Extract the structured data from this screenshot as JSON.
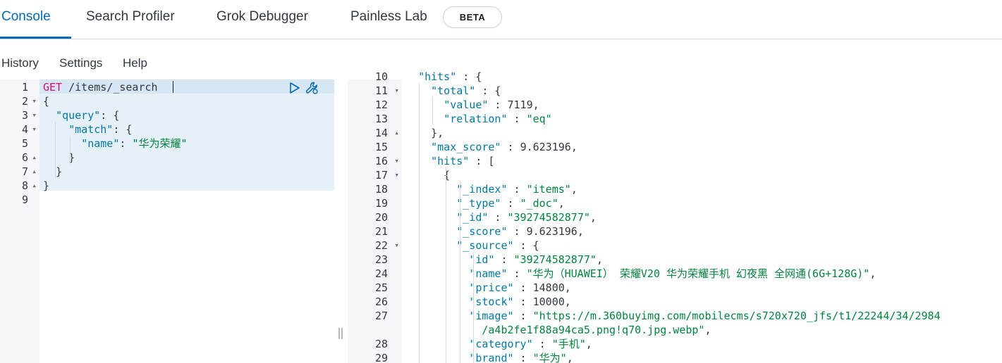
{
  "tabs": [
    {
      "label": "Console",
      "active": true
    },
    {
      "label": "Search Profiler"
    },
    {
      "label": "Grok Debugger"
    },
    {
      "label": "Painless Lab"
    }
  ],
  "beta_badge": "BETA",
  "menu": [
    "History",
    "Settings",
    "Help"
  ],
  "colors": {
    "accent": "#006bb4",
    "string": "#00843d",
    "key": "#0079a5",
    "method": "#dd0a73"
  },
  "icons": {
    "send": "play-icon",
    "settings": "wrench-icon",
    "resize": "resize-handle-icon"
  },
  "request": {
    "line_numbers": [
      "1",
      "2",
      "3",
      "4",
      "5",
      "6",
      "7",
      "8",
      "9"
    ],
    "lines": [
      [
        {
          "t": "m",
          "v": "GET"
        },
        {
          "t": "n",
          "v": " /items/_search"
        }
      ],
      [
        {
          "t": "p",
          "v": "{"
        }
      ],
      [
        {
          "t": "p",
          "v": "  "
        },
        {
          "t": "k",
          "v": "\"query\""
        },
        {
          "t": "p",
          "v": ": {"
        }
      ],
      [
        {
          "t": "p",
          "v": "    "
        },
        {
          "t": "k",
          "v": "\"match\""
        },
        {
          "t": "p",
          "v": ": {"
        }
      ],
      [
        {
          "t": "p",
          "v": "      "
        },
        {
          "t": "k",
          "v": "\"name\""
        },
        {
          "t": "p",
          "v": ": "
        },
        {
          "t": "s",
          "v": "\"华为荣耀\""
        }
      ],
      [
        {
          "t": "p",
          "v": "    }"
        }
      ],
      [
        {
          "t": "p",
          "v": "  }"
        }
      ],
      [
        {
          "t": "p",
          "v": "}"
        }
      ],
      []
    ]
  },
  "response": {
    "line_numbers": [
      "10",
      "11",
      "12",
      "13",
      "14",
      "15",
      "16",
      "17",
      "18",
      "19",
      "20",
      "21",
      "22",
      "23",
      "24",
      "25",
      "26",
      "27",
      "",
      "28",
      "29"
    ],
    "lines": [
      [
        {
          "t": "p",
          "v": "  "
        },
        {
          "t": "k",
          "v": "\"hits\""
        },
        {
          "t": "p",
          "v": " : {"
        }
      ],
      [
        {
          "t": "p",
          "v": "    "
        },
        {
          "t": "k",
          "v": "\"total\""
        },
        {
          "t": "p",
          "v": " : {"
        }
      ],
      [
        {
          "t": "p",
          "v": "      "
        },
        {
          "t": "k",
          "v": "\"value\""
        },
        {
          "t": "p",
          "v": " : "
        },
        {
          "t": "n",
          "v": "7119"
        },
        {
          "t": "p",
          "v": ","
        }
      ],
      [
        {
          "t": "p",
          "v": "      "
        },
        {
          "t": "k",
          "v": "\"relation\""
        },
        {
          "t": "p",
          "v": " : "
        },
        {
          "t": "s",
          "v": "\"eq\""
        }
      ],
      [
        {
          "t": "p",
          "v": "    },"
        }
      ],
      [
        {
          "t": "p",
          "v": "    "
        },
        {
          "t": "k",
          "v": "\"max_score\""
        },
        {
          "t": "p",
          "v": " : "
        },
        {
          "t": "n",
          "v": "9.623196"
        },
        {
          "t": "p",
          "v": ","
        }
      ],
      [
        {
          "t": "p",
          "v": "    "
        },
        {
          "t": "k",
          "v": "\"hits\""
        },
        {
          "t": "p",
          "v": " : ["
        }
      ],
      [
        {
          "t": "p",
          "v": "      {"
        }
      ],
      [
        {
          "t": "p",
          "v": "        "
        },
        {
          "t": "k",
          "v": "\"_index\""
        },
        {
          "t": "p",
          "v": " : "
        },
        {
          "t": "s",
          "v": "\"items\""
        },
        {
          "t": "p",
          "v": ","
        }
      ],
      [
        {
          "t": "p",
          "v": "        "
        },
        {
          "t": "k",
          "v": "\"_type\""
        },
        {
          "t": "p",
          "v": " : "
        },
        {
          "t": "s",
          "v": "\"_doc\""
        },
        {
          "t": "p",
          "v": ","
        }
      ],
      [
        {
          "t": "p",
          "v": "        "
        },
        {
          "t": "k",
          "v": "\"_id\""
        },
        {
          "t": "p",
          "v": " : "
        },
        {
          "t": "s",
          "v": "\"39274582877\""
        },
        {
          "t": "p",
          "v": ","
        }
      ],
      [
        {
          "t": "p",
          "v": "        "
        },
        {
          "t": "k",
          "v": "\"_score\""
        },
        {
          "t": "p",
          "v": " : "
        },
        {
          "t": "n",
          "v": "9.623196"
        },
        {
          "t": "p",
          "v": ","
        }
      ],
      [
        {
          "t": "p",
          "v": "        "
        },
        {
          "t": "k",
          "v": "\"_source\""
        },
        {
          "t": "p",
          "v": " : {"
        }
      ],
      [
        {
          "t": "p",
          "v": "          "
        },
        {
          "t": "k",
          "v": "\"id\""
        },
        {
          "t": "p",
          "v": " : "
        },
        {
          "t": "s",
          "v": "\"39274582877\""
        },
        {
          "t": "p",
          "v": ","
        }
      ],
      [
        {
          "t": "p",
          "v": "          "
        },
        {
          "t": "k",
          "v": "\"name\""
        },
        {
          "t": "p",
          "v": " : "
        },
        {
          "t": "s",
          "v": "\"华为（HUAWEI） 荣耀V20 华为荣耀手机 幻夜黑 全网通(6G+128G)\""
        },
        {
          "t": "p",
          "v": ","
        }
      ],
      [
        {
          "t": "p",
          "v": "          "
        },
        {
          "t": "k",
          "v": "\"price\""
        },
        {
          "t": "p",
          "v": " : "
        },
        {
          "t": "n",
          "v": "14800"
        },
        {
          "t": "p",
          "v": ","
        }
      ],
      [
        {
          "t": "p",
          "v": "          "
        },
        {
          "t": "k",
          "v": "\"stock\""
        },
        {
          "t": "p",
          "v": " : "
        },
        {
          "t": "n",
          "v": "10000"
        },
        {
          "t": "p",
          "v": ","
        }
      ],
      [
        {
          "t": "p",
          "v": "          "
        },
        {
          "t": "k",
          "v": "\"image\""
        },
        {
          "t": "p",
          "v": " : "
        },
        {
          "t": "s",
          "v": "\"https://m.360buyimg.com/mobilecms/s720x720_jfs/t1/22244/34/2984"
        }
      ],
      [
        {
          "t": "s",
          "v": "            /a4b2fe1f88a94ca5.png!q70.jpg.webp\""
        },
        {
          "t": "p",
          "v": ","
        }
      ],
      [
        {
          "t": "p",
          "v": "          "
        },
        {
          "t": "k",
          "v": "\"category\""
        },
        {
          "t": "p",
          "v": " : "
        },
        {
          "t": "s",
          "v": "\"手机\""
        },
        {
          "t": "p",
          "v": ","
        }
      ],
      [
        {
          "t": "p",
          "v": "          "
        },
        {
          "t": "k",
          "v": "\"brand\""
        },
        {
          "t": "p",
          "v": " : "
        },
        {
          "t": "s",
          "v": "\"华为\""
        },
        {
          "t": "p",
          "v": ","
        }
      ]
    ]
  }
}
